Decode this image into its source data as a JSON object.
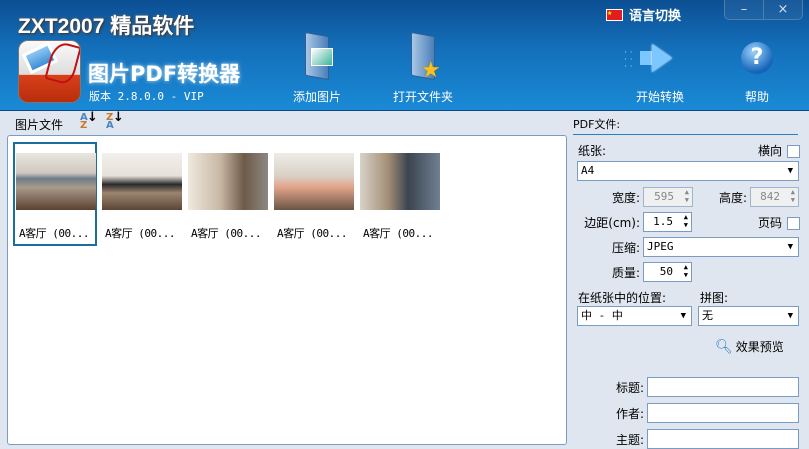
{
  "header": {
    "brand": "ZXT2007 精品软件",
    "app_title": "图片PDF转换器",
    "version": "版本 2.8.0.0 - VIP",
    "language_label": "语言切换",
    "minimize": "–",
    "close": "×"
  },
  "toolbar": {
    "add_images": "添加图片",
    "open_folder": "打开文件夹",
    "start_convert": "开始转换",
    "help": "帮助"
  },
  "file_list": {
    "label": "图片文件",
    "sort_az": "A-Z",
    "sort_za": "Z-A",
    "items": [
      {
        "caption": "A客厅 (00...",
        "selected": true
      },
      {
        "caption": "A客厅 (00...",
        "selected": false
      },
      {
        "caption": "A客厅 (00...",
        "selected": false
      },
      {
        "caption": "A客厅 (00...",
        "selected": false
      },
      {
        "caption": "A客厅 (00...",
        "selected": false
      }
    ]
  },
  "pdf": {
    "section": "PDF文件:",
    "paper_label": "纸张:",
    "landscape_label": "横向",
    "paper": "A4",
    "width_label": "宽度:",
    "width": "595",
    "height_label": "高度:",
    "height": "842",
    "margin_label": "边距(cm):",
    "margin": "1.5",
    "page_num_label": "页码",
    "compression_label": "压缩:",
    "compression": "JPEG",
    "quality_label": "质量:",
    "quality": "50",
    "position_label": "在纸张中的位置:",
    "position": "中 - 中",
    "collage_label": "拼图:",
    "collage": "无",
    "preview": "效果预览",
    "title_label": "标题:",
    "author_label": "作者:",
    "subject_label": "主题:"
  }
}
